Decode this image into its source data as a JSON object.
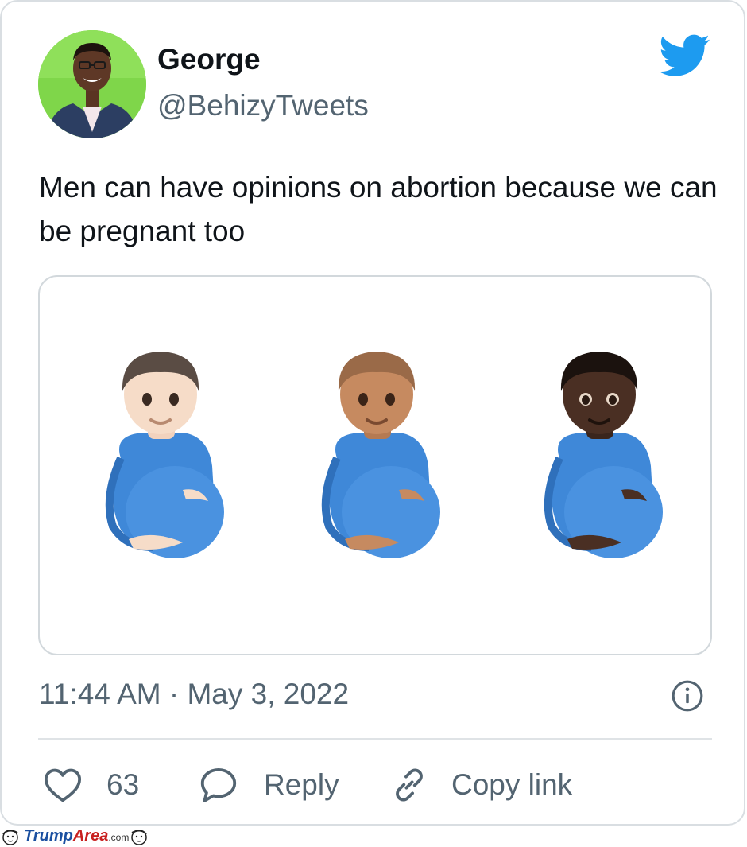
{
  "author": {
    "display_name": "George",
    "handle": "@BehizyTweets",
    "avatar_icon": "avatar-photo",
    "avatar_bg": "#7fd64a"
  },
  "tweet": {
    "text": "Men can have opinions on abortion because we can be pregnant too",
    "media": [
      {
        "icon": "pregnant-man-light-skin-emoji"
      },
      {
        "icon": "pregnant-man-medium-skin-emoji"
      },
      {
        "icon": "pregnant-man-dark-skin-emoji"
      }
    ],
    "timestamp": "11:44 AM · May 3, 2022"
  },
  "actions": {
    "like_count": "63",
    "reply_label": "Reply",
    "copy_link_label": "Copy link"
  },
  "watermark": {
    "part1": "Trump",
    "part2": "Area",
    "suffix": ".com"
  },
  "colors": {
    "twitter_blue": "#1d9bf0",
    "text": "#0f1419",
    "secondary_text": "#536471",
    "shirt_blue": "#3f88d8"
  }
}
